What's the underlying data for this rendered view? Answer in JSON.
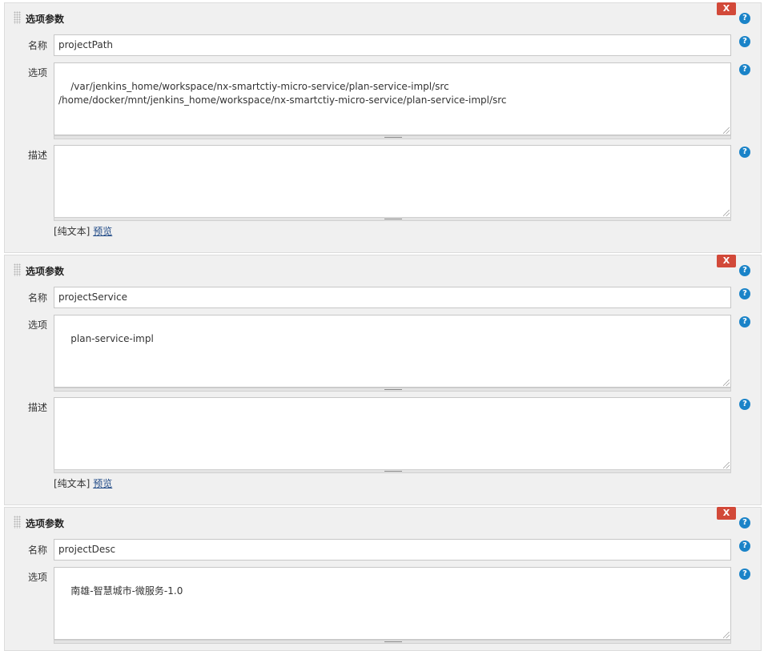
{
  "blocks": [
    {
      "title": "选项参数",
      "close_label": "X",
      "name_label": "名称",
      "name_value": "projectPath",
      "choices_label": "选项",
      "choices_value": "/var/jenkins_home/workspace/nx-smartctiy-micro-service/plan-service-impl/src\n/home/docker/mnt/jenkins_home/workspace/nx-smartctiy-micro-service/plan-service-impl/src",
      "desc_label": "描述",
      "desc_value": "",
      "format_plain": "[纯文本]",
      "format_preview": "预览"
    },
    {
      "title": "选项参数",
      "close_label": "X",
      "name_label": "名称",
      "name_value": "projectService",
      "choices_label": "选项",
      "choices_value": "plan-service-impl",
      "desc_label": "描述",
      "desc_value": "",
      "format_plain": "[纯文本]",
      "format_preview": "预览"
    },
    {
      "title": "选项参数",
      "close_label": "X",
      "name_label": "名称",
      "name_value": "projectDesc",
      "choices_label": "选项",
      "choices_value": "南雄-智慧城市-微服务-1.0"
    }
  ],
  "help_icon": "?",
  "colors": {
    "close_button": "#d24939",
    "help_icon": "#1a83c8",
    "preview_link": "#204a87",
    "panel_background": "#f0f0f0"
  }
}
